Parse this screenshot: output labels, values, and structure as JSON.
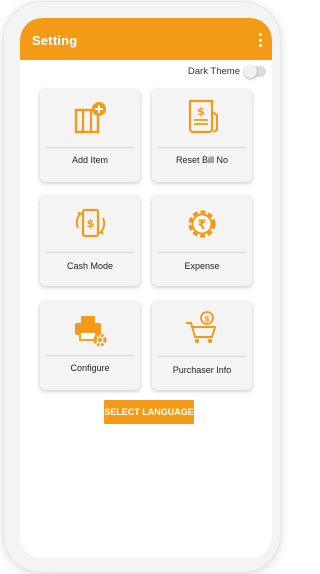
{
  "appbar": {
    "title": "Setting"
  },
  "theme": {
    "label": "Dark Theme",
    "enabled": false
  },
  "cards": [
    {
      "label": "Add Item",
      "icon": "add-item-icon"
    },
    {
      "label": "Reset Bill No",
      "icon": "bill-receipt-icon"
    },
    {
      "label": "Cash Mode",
      "icon": "cash-mode-icon"
    },
    {
      "label": "Expense",
      "icon": "rupee-gear-icon"
    },
    {
      "label": "Configure",
      "icon": "printer-gear-icon"
    },
    {
      "label": "Purchaser Info",
      "icon": "shopping-cart-icon"
    }
  ],
  "language_button": {
    "label": "SELECT LANGUAGE"
  },
  "colors": {
    "accent": "#f39a17",
    "card_bg": "#f4f4f4"
  }
}
